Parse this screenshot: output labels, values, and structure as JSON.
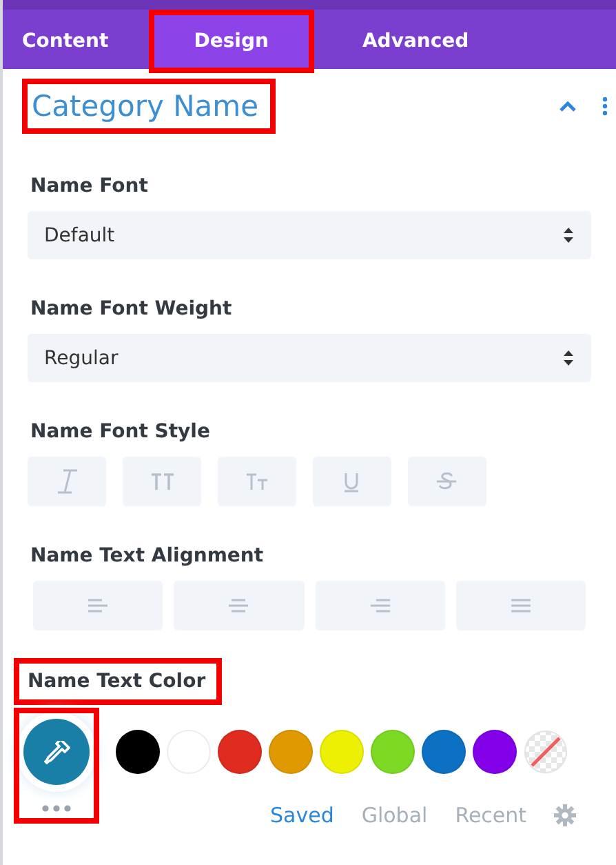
{
  "tabs": [
    {
      "label": "Content",
      "selected": false,
      "highlighted": false
    },
    {
      "label": "Design",
      "selected": true,
      "highlighted": true
    },
    {
      "label": "Advanced",
      "selected": false,
      "highlighted": false
    }
  ],
  "section": {
    "title": "Category Name",
    "highlighted": true,
    "expanded": true
  },
  "fields": [
    {
      "kind": "select",
      "label": "Name Font",
      "value": "Default"
    },
    {
      "kind": "select",
      "label": "Name Font Weight",
      "value": "Regular"
    },
    {
      "kind": "styles",
      "label": "Name Font Style",
      "buttons": [
        {
          "kind": "italic",
          "selected": false
        },
        {
          "kind": "uppercase",
          "selected": false
        },
        {
          "kind": "smallcaps",
          "selected": false
        },
        {
          "kind": "underline",
          "selected": false
        },
        {
          "kind": "strike",
          "selected": false
        }
      ]
    },
    {
      "kind": "align",
      "label": "Name Text Alignment",
      "buttons": [
        {
          "kind": "left",
          "selected": false
        },
        {
          "kind": "center",
          "selected": false
        },
        {
          "kind": "right",
          "selected": false
        },
        {
          "kind": "justify",
          "selected": false
        }
      ]
    },
    {
      "kind": "color",
      "label": "Name Text Color",
      "highlighted": true,
      "picker_highlighted": true,
      "swatches": [
        {
          "color": "#000000"
        },
        {
          "color": "#ffffff"
        },
        {
          "color": "#e02b20"
        },
        {
          "color": "#e09900"
        },
        {
          "color": "#edf000"
        },
        {
          "color": "#7cda24"
        },
        {
          "color": "#0c71c3"
        },
        {
          "color": "#8300e9"
        },
        {
          "kind": "none"
        }
      ],
      "palette_tabs": [
        {
          "label": "Saved",
          "selected": true
        },
        {
          "label": "Global",
          "selected": false
        },
        {
          "label": "Recent",
          "selected": false
        }
      ]
    }
  ]
}
